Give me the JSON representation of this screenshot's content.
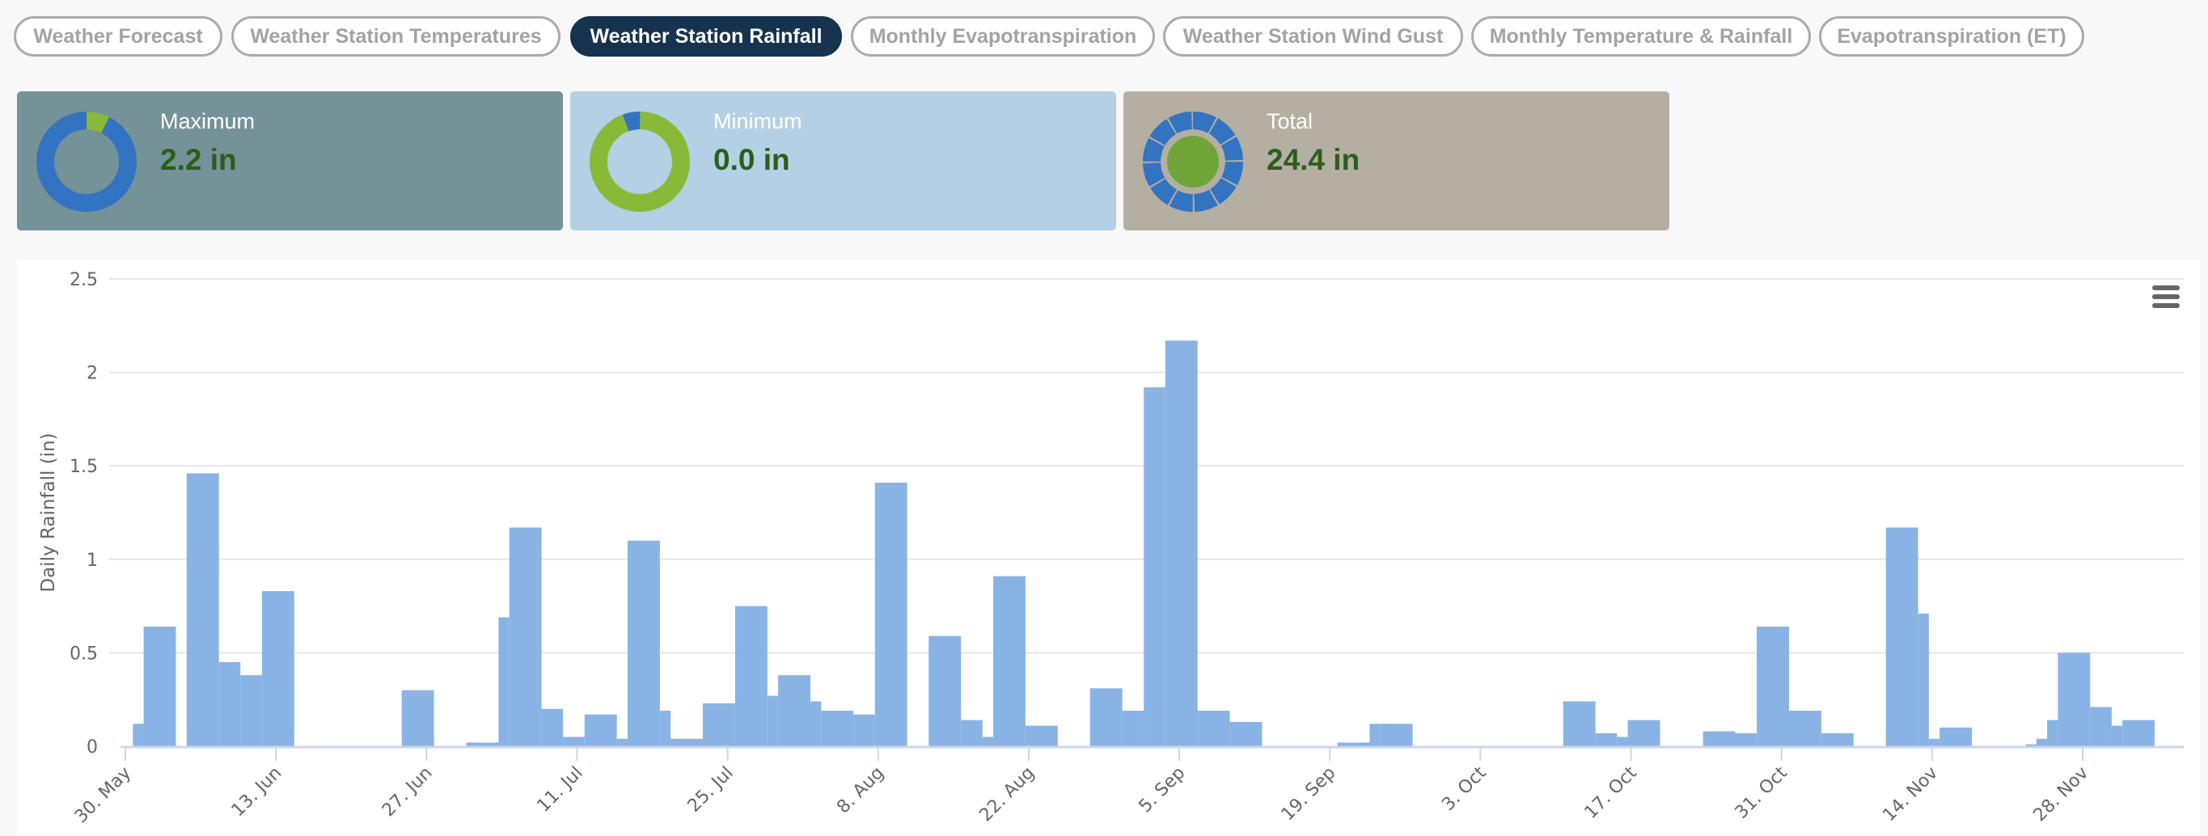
{
  "tabs": [
    {
      "label": "Weather Forecast",
      "active": false
    },
    {
      "label": "Weather Station Temperatures",
      "active": false
    },
    {
      "label": "Weather Station Rainfall",
      "active": true
    },
    {
      "label": "Monthly Evapotranspiration",
      "active": false
    },
    {
      "label": "Weather Station Wind Gust",
      "active": false
    },
    {
      "label": "Monthly Temperature & Rainfall",
      "active": false
    },
    {
      "label": "Evapotranspiration (ET)",
      "active": false
    }
  ],
  "cards": [
    {
      "label": "Maximum",
      "value": "2.2 in",
      "bg": "#759299"
    },
    {
      "label": "Minimum",
      "value": "0.0 in",
      "bg": "#b4d0e5"
    },
    {
      "label": "Total",
      "value": "24.4 in",
      "bg": "#b5aea3"
    }
  ],
  "colors": {
    "blue": "#3273c2",
    "green": "#8ab938",
    "green_dark": "#6fa536",
    "value_text": "#2a5e1a",
    "bar": "#89b3e5",
    "tab_active": "#15324f"
  },
  "menu_icon": "hamburger-menu-icon",
  "chart_data": {
    "type": "bar",
    "ylabel": "Daily Rainfall (in)",
    "ylim": [
      0,
      2.5
    ],
    "yticks": [
      "0",
      "0.5",
      "1",
      "1.5",
      "2",
      "2.5"
    ],
    "xticks": [
      "30. May",
      "13. Jun",
      "27. Jun",
      "11. Jul",
      "25. Jul",
      "8. Aug",
      "22. Aug",
      "5. Sep",
      "19. Sep",
      "3. Oct",
      "17. Oct",
      "31. Oct",
      "14. Nov",
      "28. Nov"
    ],
    "grid": true,
    "points": [
      [
        "05-31",
        0.12
      ],
      [
        "06-01",
        0.64
      ],
      [
        "06-05",
        1.46
      ],
      [
        "06-08",
        0.45
      ],
      [
        "06-10",
        0.38
      ],
      [
        "06-12",
        0.83
      ],
      [
        "06-25",
        0.3
      ],
      [
        "07-01",
        0.02
      ],
      [
        "07-04",
        0.69
      ],
      [
        "07-05",
        1.17
      ],
      [
        "07-08",
        0.2
      ],
      [
        "07-10",
        0.05
      ],
      [
        "07-12",
        0.17
      ],
      [
        "07-15",
        0.04
      ],
      [
        "07-16",
        1.1
      ],
      [
        "07-19",
        0.19
      ],
      [
        "07-20",
        0.04
      ],
      [
        "07-23",
        0.23
      ],
      [
        "07-26",
        0.75
      ],
      [
        "07-29",
        0.27
      ],
      [
        "07-30",
        0.38
      ],
      [
        "08-02",
        0.24
      ],
      [
        "08-03",
        0.19
      ],
      [
        "08-06",
        0.17
      ],
      [
        "08-08",
        1.41
      ],
      [
        "08-13",
        0.59
      ],
      [
        "08-16",
        0.14
      ],
      [
        "08-18",
        0.05
      ],
      [
        "08-19",
        0.91
      ],
      [
        "08-22",
        0.11
      ],
      [
        "08-28",
        0.31
      ],
      [
        "08-31",
        0.19
      ],
      [
        "09-02",
        1.92
      ],
      [
        "09-04",
        2.17
      ],
      [
        "09-07",
        0.19
      ],
      [
        "09-10",
        0.13
      ],
      [
        "09-20",
        0.02
      ],
      [
        "09-23",
        0.12
      ],
      [
        "09-24",
        0.12
      ],
      [
        "10-11",
        0.24
      ],
      [
        "10-14",
        0.07
      ],
      [
        "10-16",
        0.05
      ],
      [
        "10-17",
        0.14
      ],
      [
        "10-24",
        0.08
      ],
      [
        "10-27",
        0.07
      ],
      [
        "10-29",
        0.64
      ],
      [
        "11-01",
        0.19
      ],
      [
        "11-04",
        0.07
      ],
      [
        "11-10",
        1.17
      ],
      [
        "11-13",
        0.71
      ],
      [
        "11-14",
        0.04
      ],
      [
        "11-15",
        0.1
      ],
      [
        "11-23",
        0.01
      ],
      [
        "11-24",
        0.04
      ],
      [
        "11-25",
        0.14
      ],
      [
        "11-26",
        0.5
      ],
      [
        "11-29",
        0.21
      ],
      [
        "12-01",
        0.11
      ],
      [
        "12-02",
        0.14
      ]
    ]
  }
}
